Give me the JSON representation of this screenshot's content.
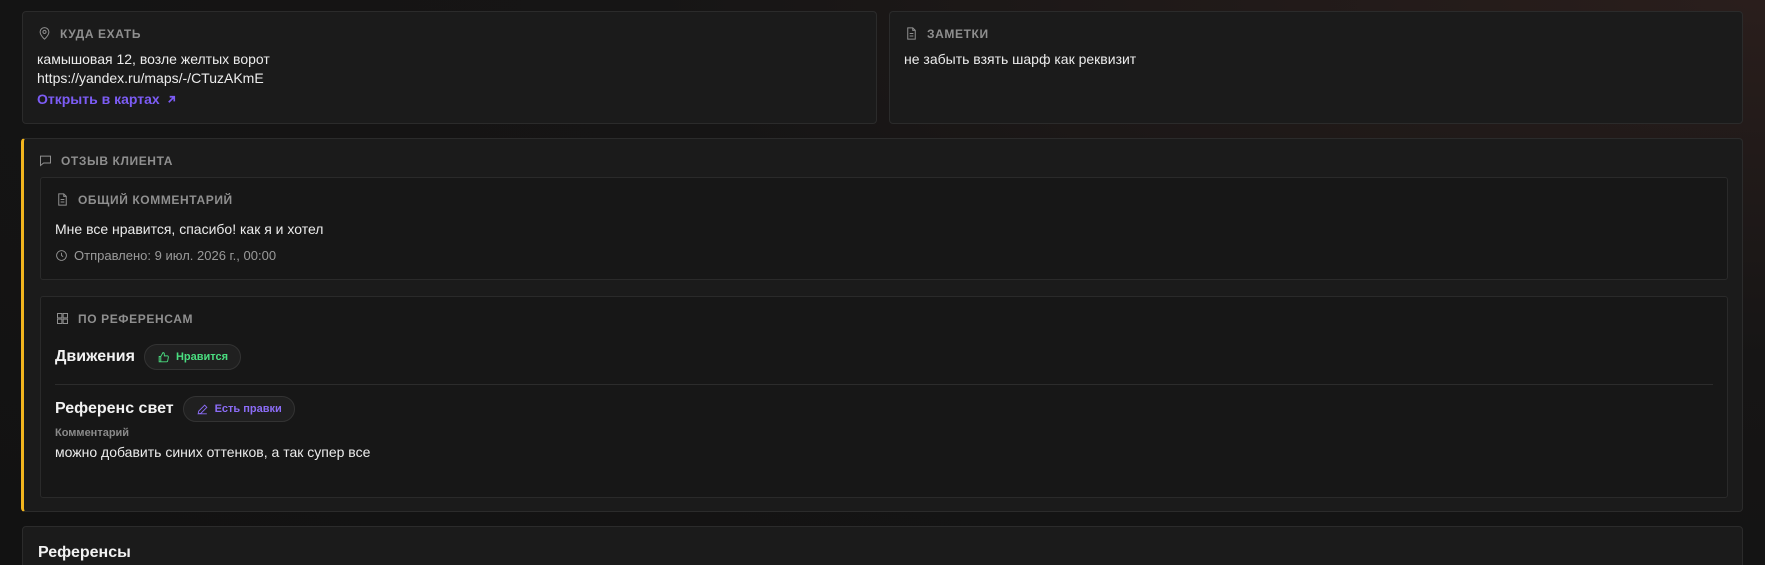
{
  "where": {
    "title": "КУДА ЕХАТЬ",
    "address": "камышовая 12, возле желтых ворот",
    "url": "https://yandex.ru/maps/-/CTuzAKmE",
    "open_link": "Открыть в картах"
  },
  "notes": {
    "title": "ЗАМЕТКИ",
    "text": "не забыть взять шарф как реквизит"
  },
  "feedback": {
    "title": "ОТЗЫВ КЛИЕНТА",
    "accent_color": "#f2b51e",
    "general": {
      "title": "ОБЩИЙ КОММЕНТАРИЙ",
      "comment": "Мне все нравится, спасибо! как я и хотел",
      "sent": "Отправлено: 9 июл. 2026 г., 00:00"
    },
    "references": {
      "title": "ПО РЕФЕРЕНСАМ",
      "items": [
        {
          "name": "Движения",
          "status": "Нравится",
          "status_icon": "thumbs-up-icon",
          "status_color": "#4ade80"
        },
        {
          "name": "Референс свет",
          "status": "Есть правки",
          "status_icon": "pencil-icon",
          "status_color": "#8b6cf6",
          "comment_label": "Комментарий",
          "comment": "можно добавить синих оттенков, а так супер все"
        }
      ]
    }
  },
  "references_section": {
    "heading": "Референсы"
  }
}
